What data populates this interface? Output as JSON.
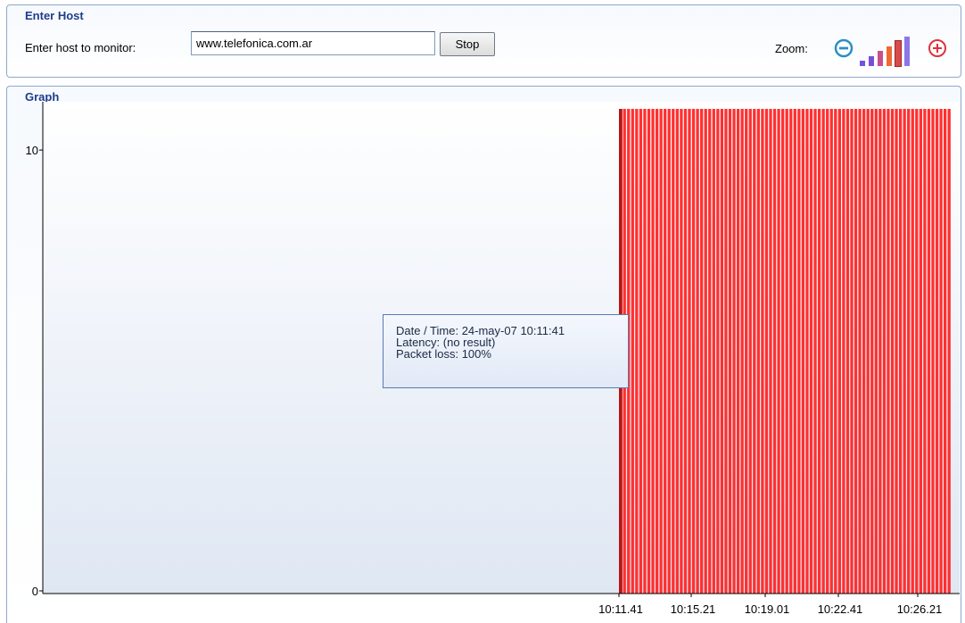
{
  "host_panel": {
    "title": "Enter Host",
    "label": "Enter host to monitor:",
    "host_value": "www.telefonica.com.ar",
    "stop_label": "Stop",
    "zoom_label": "Zoom:",
    "zoom_out_icon": "zoom-out-icon",
    "zoom_in_icon": "zoom-in-icon",
    "zoom_levels": [
      {
        "level": 1,
        "color": "#6f52e6"
      },
      {
        "level": 2,
        "color": "#7a4fd8"
      },
      {
        "level": 3,
        "color": "#c84f8a"
      },
      {
        "level": 4,
        "color": "#ee6a33"
      },
      {
        "level": 5,
        "color": "#d94a4a"
      },
      {
        "level": 6,
        "color": "#8b78e8"
      }
    ],
    "zoom_selected_level": 5,
    "accent_color": "#1e3c8c"
  },
  "graph_panel": {
    "title": "Graph"
  },
  "tooltip": {
    "datetime": "Date / Time: 24-may-07 10:11:41",
    "latency": "Latency: (no result)",
    "packet_loss": "Packet loss: 100%"
  },
  "chart_data": {
    "type": "bar",
    "title": "",
    "xlabel": "",
    "ylabel": "",
    "ylim": [
      0,
      11
    ],
    "y_ticks": [
      "0",
      "10"
    ],
    "x_tick_labels": [
      "10:11.41",
      "10:15.21",
      "10:19.01",
      "10:22.41",
      "10:26.21"
    ],
    "bar_color": "#ff3030",
    "first_bar_color": "#b81414",
    "bar_count": 82,
    "bar_value": 11,
    "bar_status": "no result (100% packet loss)",
    "bars_start_time": "10:11.41"
  }
}
